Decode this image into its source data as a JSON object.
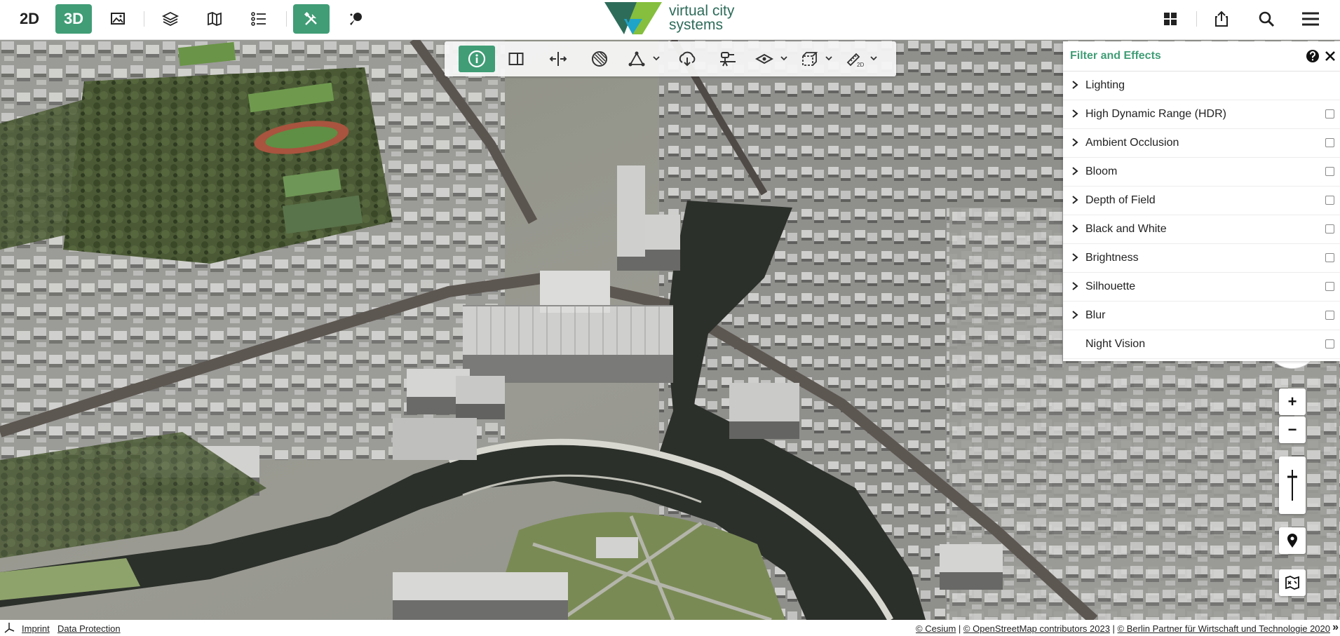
{
  "header": {
    "view_2d": "2D",
    "view_3d": "3D",
    "logo_line1": "virtual city",
    "logo_line2": "systems",
    "accent": "#409d76"
  },
  "toolbar": {
    "tools": [
      "info-icon",
      "sidebar-panel-icon",
      "split-view-icon",
      "shadow-icon",
      "draw-shape-icon",
      "download-cloud-icon",
      "viewshed-icon",
      "layer-visibility-icon",
      "clipping-box-icon",
      "measure-2d-icon"
    ],
    "measure_badge": "2D"
  },
  "filter_panel": {
    "title": "Filter and Effects",
    "items": [
      {
        "label": "Lighting",
        "expandable": true,
        "checkbox": false,
        "checked": false
      },
      {
        "label": "High Dynamic Range (HDR)",
        "expandable": true,
        "checkbox": true,
        "checked": false
      },
      {
        "label": "Ambient Occlusion",
        "expandable": true,
        "checkbox": true,
        "checked": false
      },
      {
        "label": "Bloom",
        "expandable": true,
        "checkbox": true,
        "checked": false
      },
      {
        "label": "Depth of Field",
        "expandable": true,
        "checkbox": true,
        "checked": false
      },
      {
        "label": "Black and White",
        "expandable": true,
        "checkbox": true,
        "checked": false
      },
      {
        "label": "Brightness",
        "expandable": true,
        "checkbox": true,
        "checked": false
      },
      {
        "label": "Silhouette",
        "expandable": true,
        "checkbox": true,
        "checked": false
      },
      {
        "label": "Blur",
        "expandable": true,
        "checkbox": true,
        "checked": false
      },
      {
        "label": "Night Vision",
        "expandable": false,
        "checkbox": true,
        "checked": false
      }
    ]
  },
  "nav": {
    "zoom_in": "+",
    "zoom_out": "−"
  },
  "footer": {
    "imprint": "Imprint",
    "data_protection": "Data Protection",
    "attr_cesium": "© Cesium",
    "attr_sep1": " | ",
    "attr_osm": "© OpenStreetMap contributors 2023",
    "attr_sep2": " | ",
    "attr_berlin": "© Berlin Partner für Wirtschaft und Technologie 2020",
    "more": "»"
  }
}
